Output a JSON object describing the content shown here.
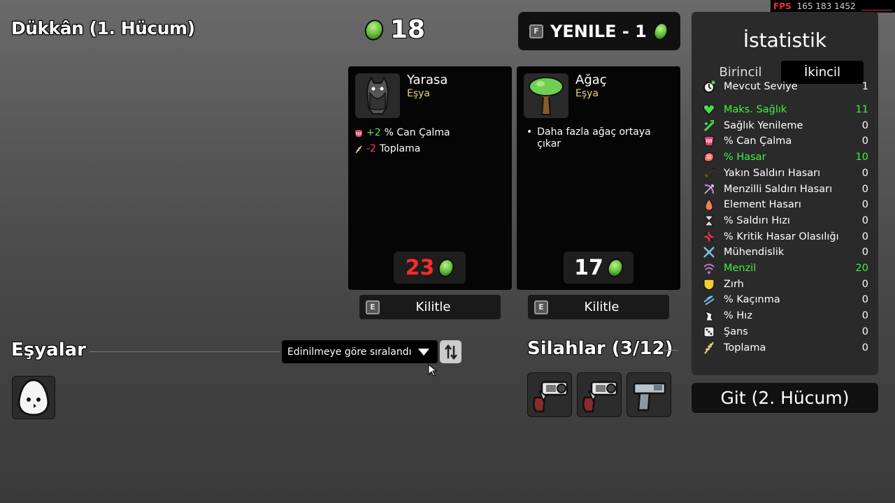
{
  "shop_title": "Dükkân (1. Hücum)",
  "fps": {
    "label": "FPS",
    "values": "165 183 1452"
  },
  "materials": "18",
  "reroll": {
    "key": "F",
    "label": "YENILE - 1"
  },
  "cards": [
    {
      "name": "Yarasa",
      "type": "Eşya",
      "icon": "bat-icon",
      "effects": [
        {
          "icon": "lifesteal-icon",
          "value": "+2",
          "value_color": "#5ce65c",
          "text": "% Can Çalma"
        },
        {
          "icon": "harvesting-icon",
          "value": "-2",
          "value_color": "#ff4444",
          "text": "Toplama"
        }
      ],
      "price": "23",
      "price_color": "#ff2a2a",
      "lock_key": "E",
      "lock_label": "Kilitle"
    },
    {
      "name": "Ağaç",
      "type": "Eşya",
      "icon": "tree-icon",
      "desc_line1": "Daha fazla ağaç ortaya",
      "desc_line2": "çıkar",
      "price": "17",
      "price_color": "#ffffff",
      "lock_key": "E",
      "lock_label": "Kilitle"
    }
  ],
  "items_section": {
    "title": "Eşyalar",
    "sort_label": "Edinilmeye göre sıralandı",
    "items": [
      "egg-item-icon"
    ]
  },
  "weapons_section": {
    "title": "Silahlar (3/12)",
    "weapons": [
      "revolver-icon",
      "revolver-icon",
      "pistol-icon"
    ]
  },
  "stats": {
    "title": "İstatistik",
    "tabs": [
      {
        "label": "Birincil",
        "active": false
      },
      {
        "label": "İkincil",
        "active": true
      }
    ],
    "level": {
      "name": "Mevcut Seviye",
      "value": "1",
      "icon": "level-icon"
    },
    "rows": [
      {
        "name": "Maks. Sağlık",
        "value": "11",
        "highlight": true,
        "icon": "heart-icon",
        "color": "#4ddb4d"
      },
      {
        "name": "Sağlık Yenileme",
        "value": "0",
        "highlight": false,
        "icon": "regen-icon",
        "color": "#4ddb4d"
      },
      {
        "name": "% Can Çalma",
        "value": "0",
        "highlight": false,
        "icon": "lifesteal-icon",
        "color": "#e0446a"
      },
      {
        "name": "% Hasar",
        "value": "10",
        "highlight": true,
        "icon": "damage-icon",
        "color": "#ff6a6a"
      },
      {
        "name": "Yakın Saldırı Hasarı",
        "value": "0",
        "highlight": false,
        "icon": "melee-icon",
        "color": "#e6d57c"
      },
      {
        "name": "Menzilli Saldırı Hasarı",
        "value": "0",
        "highlight": false,
        "icon": "ranged-icon",
        "color": "#c070d0"
      },
      {
        "name": "Element Hasarı",
        "value": "0",
        "highlight": false,
        "icon": "elemental-icon",
        "color": "#f08050"
      },
      {
        "name": "% Saldırı Hızı",
        "value": "0",
        "highlight": false,
        "icon": "hourglass-icon",
        "color": "#dddddd"
      },
      {
        "name": "% Kritik Hasar Olasılığı",
        "value": "0",
        "highlight": false,
        "icon": "crit-icon",
        "color": "#ee3355"
      },
      {
        "name": "Mühendislik",
        "value": "0",
        "highlight": false,
        "icon": "engineering-icon",
        "color": "#80c0e0"
      },
      {
        "name": "Menzil",
        "value": "20",
        "highlight": true,
        "icon": "range-icon",
        "color": "#c070d0"
      },
      {
        "name": "Zırh",
        "value": "0",
        "highlight": false,
        "icon": "armor-icon",
        "color": "#f0d030"
      },
      {
        "name": "% Kaçınma",
        "value": "0",
        "highlight": false,
        "icon": "dodge-icon",
        "color": "#70c0e0"
      },
      {
        "name": "% Hız",
        "value": "0",
        "highlight": false,
        "icon": "speed-icon",
        "color": "#eeeeee"
      },
      {
        "name": "Şans",
        "value": "0",
        "highlight": false,
        "icon": "dice-icon",
        "color": "#eeeeee"
      },
      {
        "name": "Toplama",
        "value": "0",
        "highlight": false,
        "icon": "harvesting-icon",
        "color": "#e6d57c"
      }
    ]
  },
  "go_button": "Git (2. Hücum)"
}
